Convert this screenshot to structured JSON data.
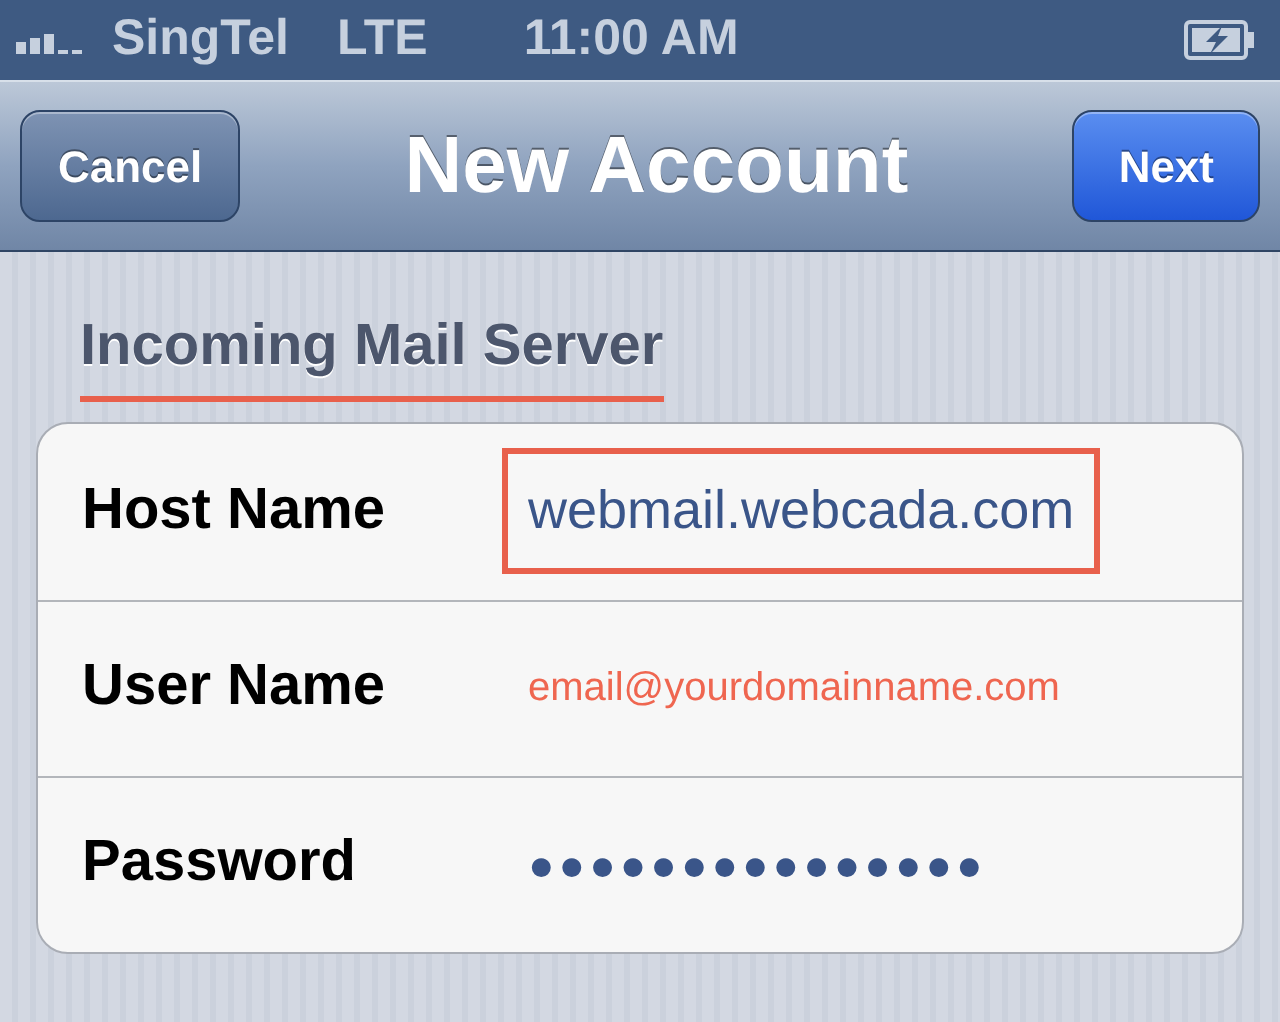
{
  "status_bar": {
    "carrier": "SingTel",
    "network": "LTE",
    "time": "11:00 AM"
  },
  "nav_bar": {
    "left_button": "Cancel",
    "title": "New Account",
    "right_button": "Next"
  },
  "section": {
    "title": "Incoming Mail Server",
    "underlined": true
  },
  "fields": [
    {
      "label": "Host Name",
      "value": "webmail.webcada.com",
      "kind": "text",
      "highlighted": true,
      "annotated": false
    },
    {
      "label": "User Name",
      "value": "email@yourdomainname.com",
      "kind": "text",
      "highlighted": false,
      "annotated": true
    },
    {
      "label": "Password",
      "value": "●●●●●●●●●●●●●●●",
      "kind": "password",
      "highlighted": false,
      "annotated": false
    }
  ]
}
